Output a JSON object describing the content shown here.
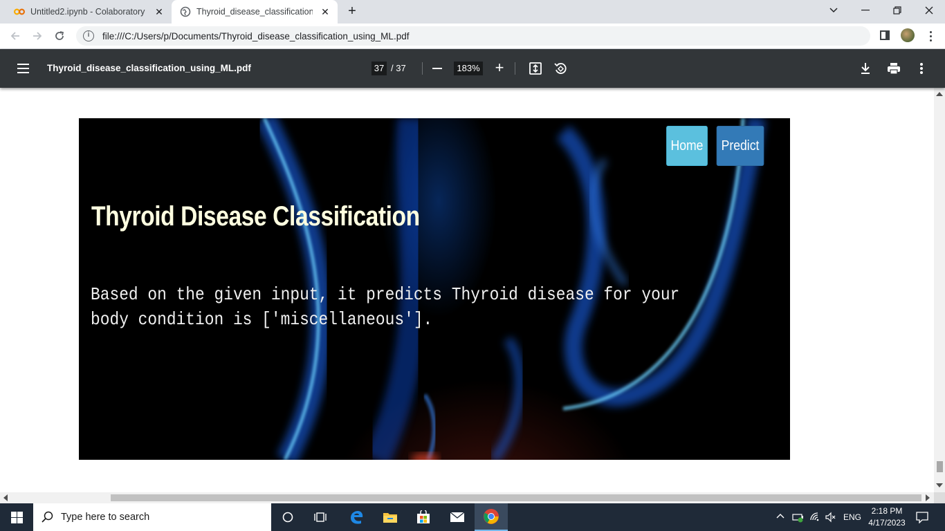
{
  "browser": {
    "tabs": [
      {
        "title": "Untitled2.ipynb - Colaboratory",
        "active": false
      },
      {
        "title": "Thyroid_disease_classification_us",
        "active": true
      }
    ],
    "url": "file:///C:/Users/p/Documents/Thyroid_disease_classification_using_ML.pdf"
  },
  "pdf_toolbar": {
    "file_name": "Thyroid_disease_classification_using_ML.pdf",
    "current_page": "37",
    "total_pages": "/ 37",
    "zoom": "183%"
  },
  "page_content": {
    "nav": {
      "home": "Home",
      "predict": "Predict"
    },
    "heading": "Thyroid Disease Classification",
    "result_text": "Based on the given input, it predicts Thyroid disease for your body condition is ['miscellaneous']."
  },
  "taskbar": {
    "search_placeholder": "Type here to search",
    "language": "ENG",
    "time": "2:18 PM",
    "date": "4/17/2023"
  },
  "colors": {
    "pdf_toolbar_bg": "#323639",
    "home_button": "#5bc0de",
    "predict_button": "#337ab7",
    "heading_color": "#ffffe0",
    "taskbar_bg": "#1f2a38"
  }
}
